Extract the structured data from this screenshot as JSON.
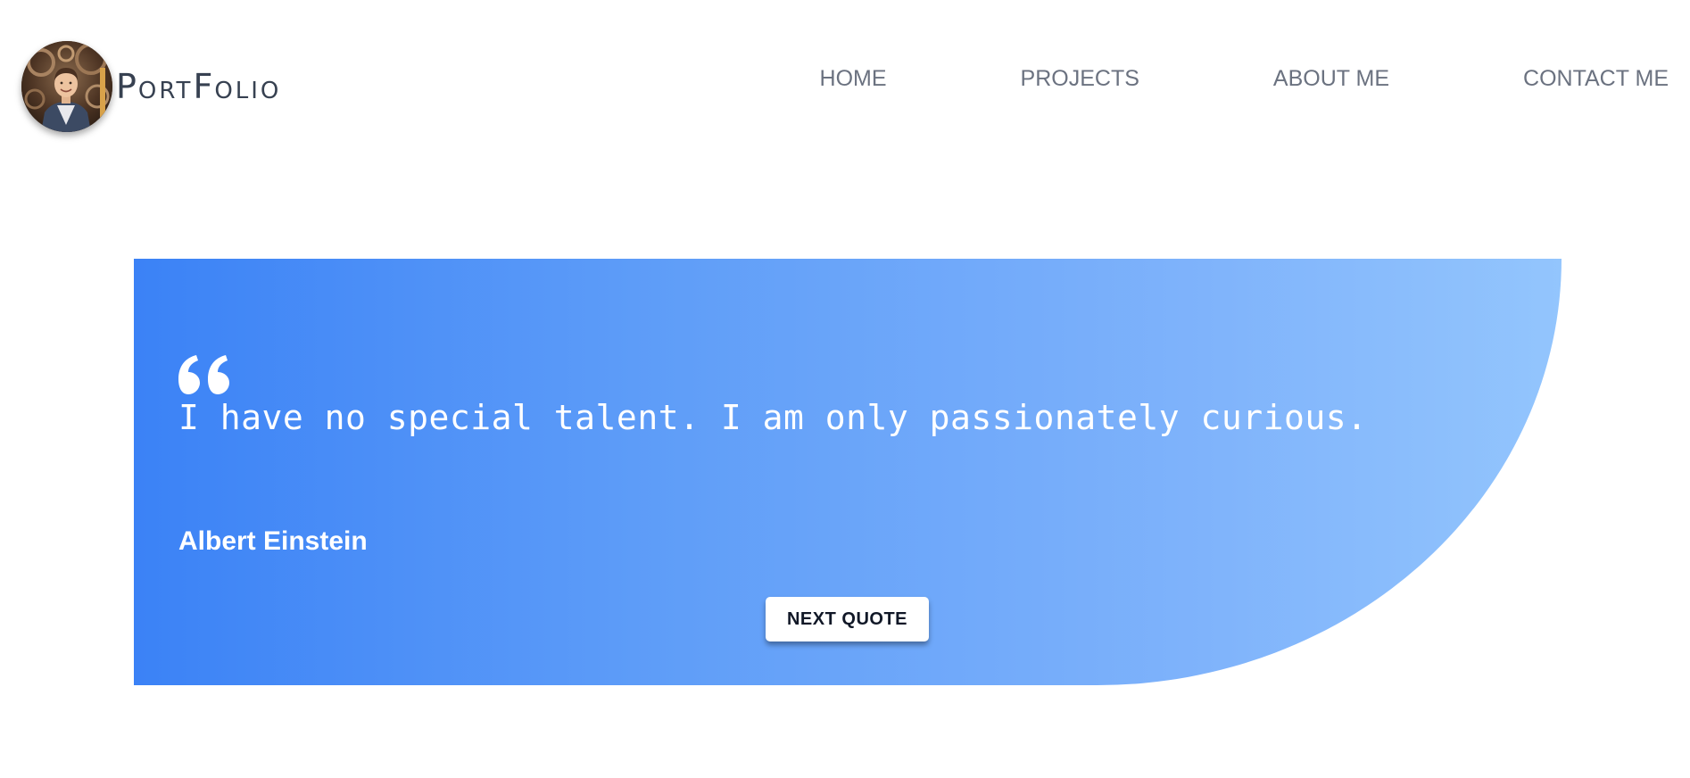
{
  "header": {
    "brand": {
      "first_initial": "P",
      "first_rest": "ORT",
      "second_initial": "F",
      "second_rest": "OLIO",
      "avatar_icon": "profile-photo"
    },
    "nav": [
      {
        "label": "HOME"
      },
      {
        "label": "PROJECTS"
      },
      {
        "label": "ABOUT ME"
      },
      {
        "label": "CONTACT ME"
      }
    ]
  },
  "quote": {
    "icon": "quote-open-icon",
    "text": "I have no special talent. I am only passionately curious.",
    "author": "Albert Einstein",
    "button_label": "NEXT QUOTE"
  },
  "colors": {
    "gradient_start": "#3b82f6",
    "gradient_end": "#93c5fd",
    "nav_text": "#6b7280",
    "brand_text": "#374151",
    "quote_text": "#ffffff",
    "button_bg": "#ffffff"
  }
}
